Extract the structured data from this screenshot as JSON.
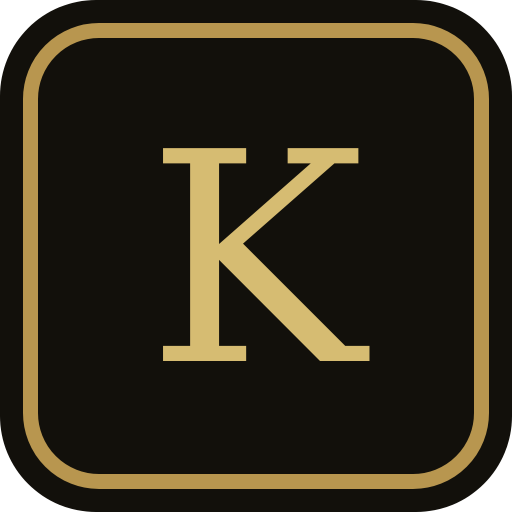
{
  "icon": {
    "letter": "K",
    "background_color": "#12100b",
    "frame_color": "#b8964f",
    "letter_color": "#d6bc72"
  }
}
